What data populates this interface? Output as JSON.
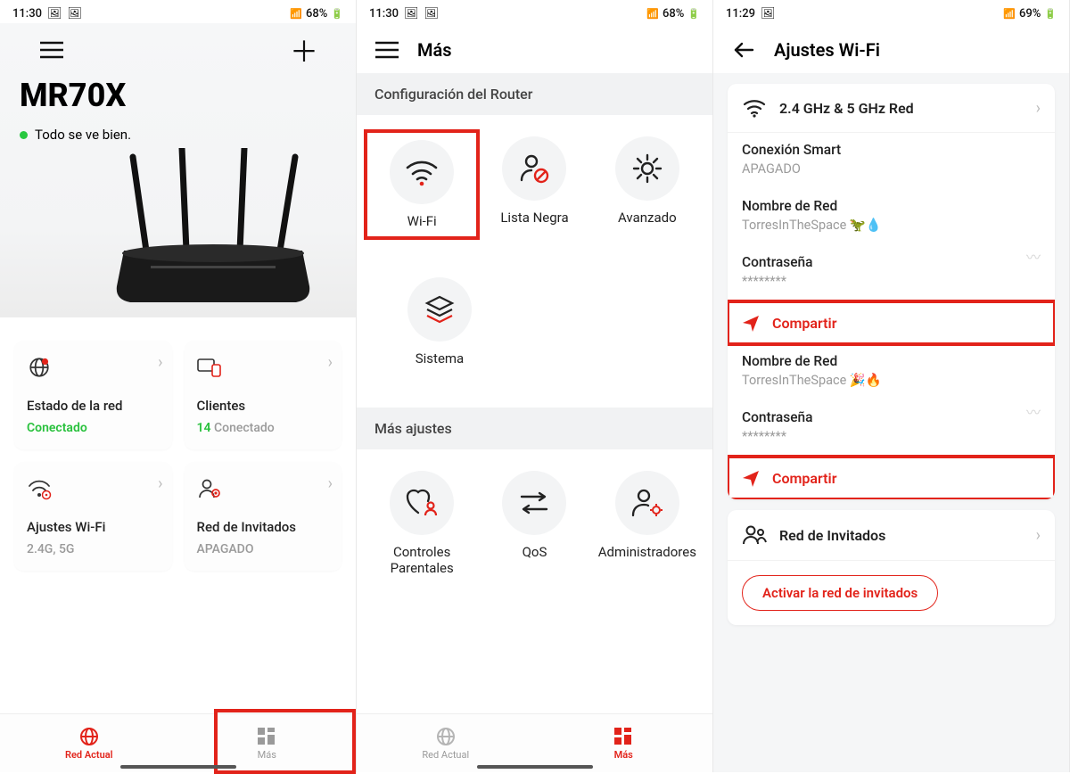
{
  "screen1": {
    "status": {
      "time": "11:30",
      "battery": "68%"
    },
    "title": "MR70X",
    "statusText": "Todo se ve bien.",
    "cards": {
      "net": {
        "label": "Estado de la red",
        "value": "Conectado"
      },
      "clients": {
        "label": "Clientes",
        "count": "14",
        "suffix": " Conectado"
      },
      "wifi": {
        "label": "Ajustes Wi-Fi",
        "value": "2.4G, 5G"
      },
      "guest": {
        "label": "Red de Invitados",
        "value": "APAGADO"
      }
    },
    "nav": {
      "current": "Red Actual",
      "more": "Más"
    }
  },
  "screen2": {
    "status": {
      "time": "11:30",
      "battery": "68%"
    },
    "title": "Más",
    "section1": "Configuración del Router",
    "tiles1": {
      "wifi": "Wi-Fi",
      "blocklist": "Lista Negra",
      "advanced": "Avanzado",
      "system": "Sistema"
    },
    "section2": "Más ajustes",
    "tiles2": {
      "parental": "Controles Parentales",
      "qos": "QoS",
      "admins": "Administradores"
    },
    "nav": {
      "current": "Red Actual",
      "more": "Más"
    }
  },
  "screen3": {
    "status": {
      "time": "11:29",
      "battery": "69%"
    },
    "title": "Ajustes Wi-Fi",
    "bandRow": "2.4 GHz & 5 GHz Red",
    "fields": {
      "smart": {
        "label": "Conexión Smart",
        "value": "APAGADO"
      },
      "ssid1": {
        "label": "Nombre de Red",
        "value": "TorresInTheSpace 🦖💧"
      },
      "pwd1": {
        "label": "Contraseña",
        "value": "********"
      },
      "ssid2": {
        "label": "Nombre de Red",
        "value": "TorresInTheSpace 🎉🔥"
      },
      "pwd2": {
        "label": "Contraseña",
        "value": "********"
      }
    },
    "share": "Compartir",
    "guestRow": "Red de Invitados",
    "guestBtn": "Activar la red de invitados"
  }
}
